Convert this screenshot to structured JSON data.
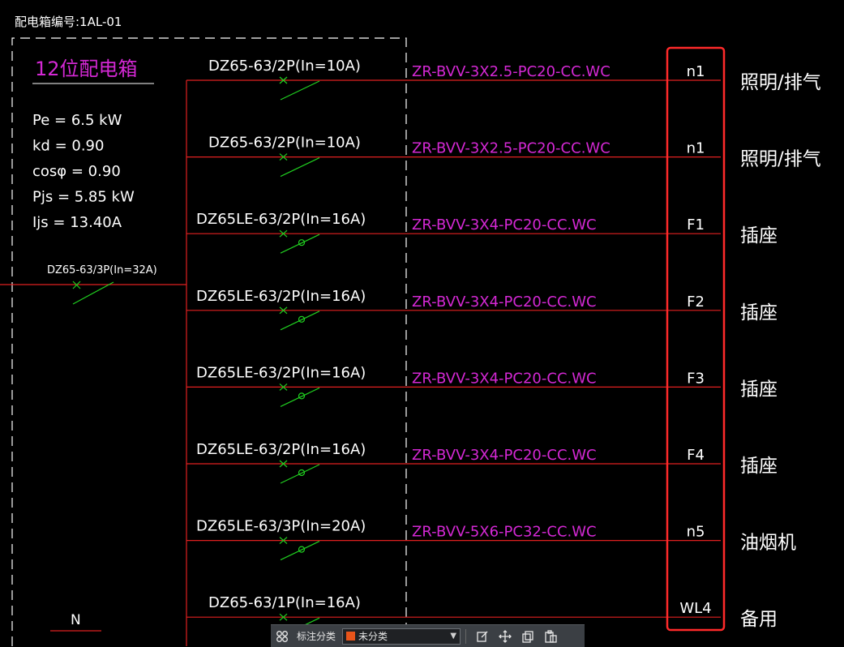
{
  "box_title": "配电箱编号:1AL-01",
  "panel": {
    "name": "12位配电箱",
    "params": [
      "Pe = 6.5  kW",
      "kd = 0.90",
      "cosφ = 0.90",
      "Pjs = 5.85  kW",
      "Ijs = 13.40A"
    ]
  },
  "main_breaker": "DZ65-63/3P(In=32A)",
  "neutral_label": "N",
  "circuits": [
    {
      "breaker": "DZ65-63/2P(In=10A)",
      "cable": "ZR-BVV-3X2.5-PC20-CC.WC",
      "code": "n1",
      "use": "照明/排气",
      "rcd": false
    },
    {
      "breaker": "DZ65-63/2P(In=10A)",
      "cable": "ZR-BVV-3X2.5-PC20-CC.WC",
      "code": "n1",
      "use": "照明/排气",
      "rcd": false
    },
    {
      "breaker": "DZ65LE-63/2P(In=16A)",
      "cable": "ZR-BVV-3X4-PC20-CC.WC",
      "code": "F1",
      "use": "插座",
      "rcd": true
    },
    {
      "breaker": "DZ65LE-63/2P(In=16A)",
      "cable": "ZR-BVV-3X4-PC20-CC.WC",
      "code": "F2",
      "use": "插座",
      "rcd": true
    },
    {
      "breaker": "DZ65LE-63/2P(In=16A)",
      "cable": "ZR-BVV-3X4-PC20-CC.WC",
      "code": "F3",
      "use": "插座",
      "rcd": true
    },
    {
      "breaker": "DZ65LE-63/2P(In=16A)",
      "cable": "ZR-BVV-3X4-PC20-CC.WC",
      "code": "F4",
      "use": "插座",
      "rcd": true
    },
    {
      "breaker": "DZ65LE-63/3P(In=20A)",
      "cable": "ZR-BVV-5X6-PC32-CC.WC",
      "code": "n5",
      "use": "油烟机",
      "rcd": true
    },
    {
      "breaker": "DZ65-63/1P(In=16A)",
      "cable": "",
      "code": "WL4",
      "use": "备用",
      "rcd": false
    }
  ],
  "toolbar": {
    "grid_icon": "grid-icon",
    "label": "标注分类",
    "selected": "未分类",
    "swatch_color": "#e8541a",
    "icons": [
      "edit-icon",
      "move-icon",
      "copy-icon",
      "paste-icon"
    ]
  },
  "colors": {
    "wire": "#e02020",
    "breaker": "#20d020",
    "cable_text": "#d428d4",
    "highlight": "#ff2a2a"
  }
}
